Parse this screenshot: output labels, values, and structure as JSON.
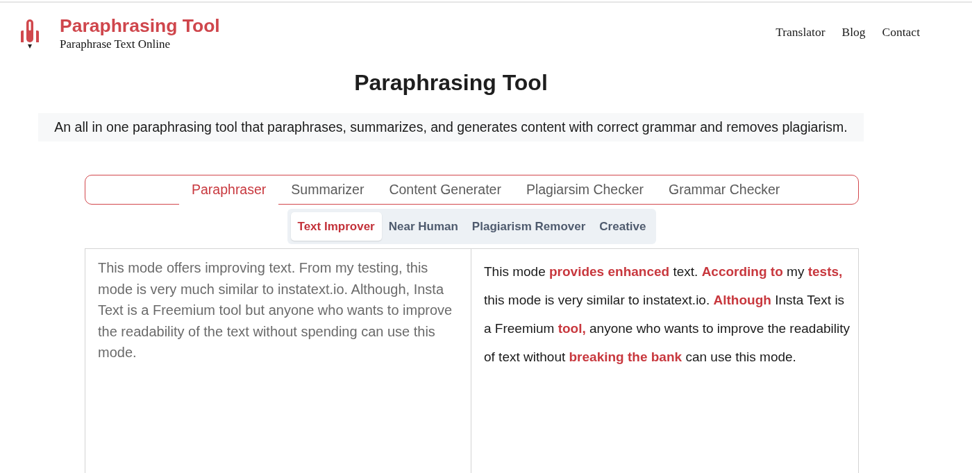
{
  "header": {
    "logo_title": "Paraphrasing Tool",
    "tagline": "Paraphrase Text Online",
    "nav": [
      {
        "label": "Translator"
      },
      {
        "label": "Blog"
      },
      {
        "label": "Contact"
      }
    ]
  },
  "page": {
    "title": "Paraphrasing Tool",
    "description": "An all in one paraphrasing tool that paraphrases, summarizes, and generates content with correct grammar and removes plagiarism."
  },
  "tool_tabs": [
    {
      "label": "Paraphraser",
      "selected": true
    },
    {
      "label": "Summarizer",
      "selected": false
    },
    {
      "label": "Content Generater",
      "selected": false
    },
    {
      "label": "Plagiarsim Checker",
      "selected": false
    },
    {
      "label": "Grammar Checker",
      "selected": false
    }
  ],
  "modes": [
    {
      "label": "Text Improver",
      "selected": true
    },
    {
      "label": "Near Human",
      "selected": false
    },
    {
      "label": "Plagiarism Remover",
      "selected": false
    },
    {
      "label": "Creative",
      "selected": false
    }
  ],
  "input": {
    "value": "This mode offers improving text. From my testing, this mode is very much similar to instatext.io. Although, Insta Text is a Freemium tool but anyone who wants to improve the readability of the text without spending can use this mode."
  },
  "output": {
    "text": "This mode **provides enhanced** text. **According to** my **tests,** this mode is very similar to instatext.io. **Although** Insta Text is a Freemium **tool,** anyone who wants to improve the readability of text without **breaking the bank** can use this mode."
  }
}
